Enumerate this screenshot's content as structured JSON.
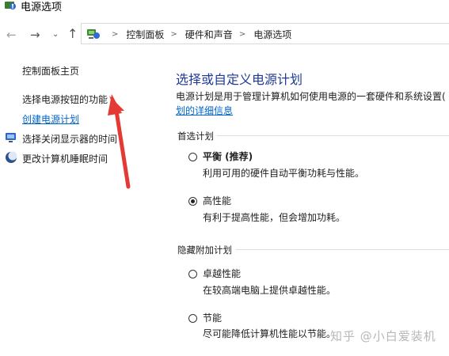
{
  "window": {
    "title": "电源选项"
  },
  "nav": {
    "back_icon": "left-arrow-icon",
    "forward_icon": "right-arrow-icon",
    "history_icon": "chevron-down-icon",
    "up_icon": "up-arrow-icon"
  },
  "breadcrumb": {
    "icon": "control-panel-icon",
    "items": [
      "控制面板",
      "硬件和声音",
      "电源选项"
    ]
  },
  "sidebar": {
    "home": "控制面板主页",
    "items": [
      {
        "label": "选择电源按钮的功能"
      },
      {
        "label": "创建电源计划"
      },
      {
        "label": "选择关闭显示器的时间",
        "icon": "display-icon"
      },
      {
        "label": "更改计算机睡眠时间",
        "icon": "sleep-moon-icon"
      }
    ]
  },
  "main": {
    "title": "选择或自定义电源计划",
    "description": "电源计划是用于管理计算机如何使用电源的一套硬件和系统设置(",
    "description_link": "划的详细信息",
    "preferred_group": "首选计划",
    "hidden_group": "隐藏附加计划",
    "plans": [
      {
        "name": "平衡 (推荐)",
        "desc": "利用可用的硬件自动平衡功耗与性能。",
        "selected": false
      },
      {
        "name": "高性能",
        "desc": "有利于提高性能，但会增加功耗。",
        "selected": true
      },
      {
        "name": "卓越性能",
        "desc": "在较高端电脑上提供卓越性能。",
        "selected": false
      },
      {
        "name": "节能",
        "desc": "尽可能降低计算机性能以节能。",
        "selected": false
      }
    ]
  },
  "watermark": "知乎 @小白爱装机",
  "annotation": {
    "color": "#e53935",
    "icon": "red-arrow-annotation"
  }
}
